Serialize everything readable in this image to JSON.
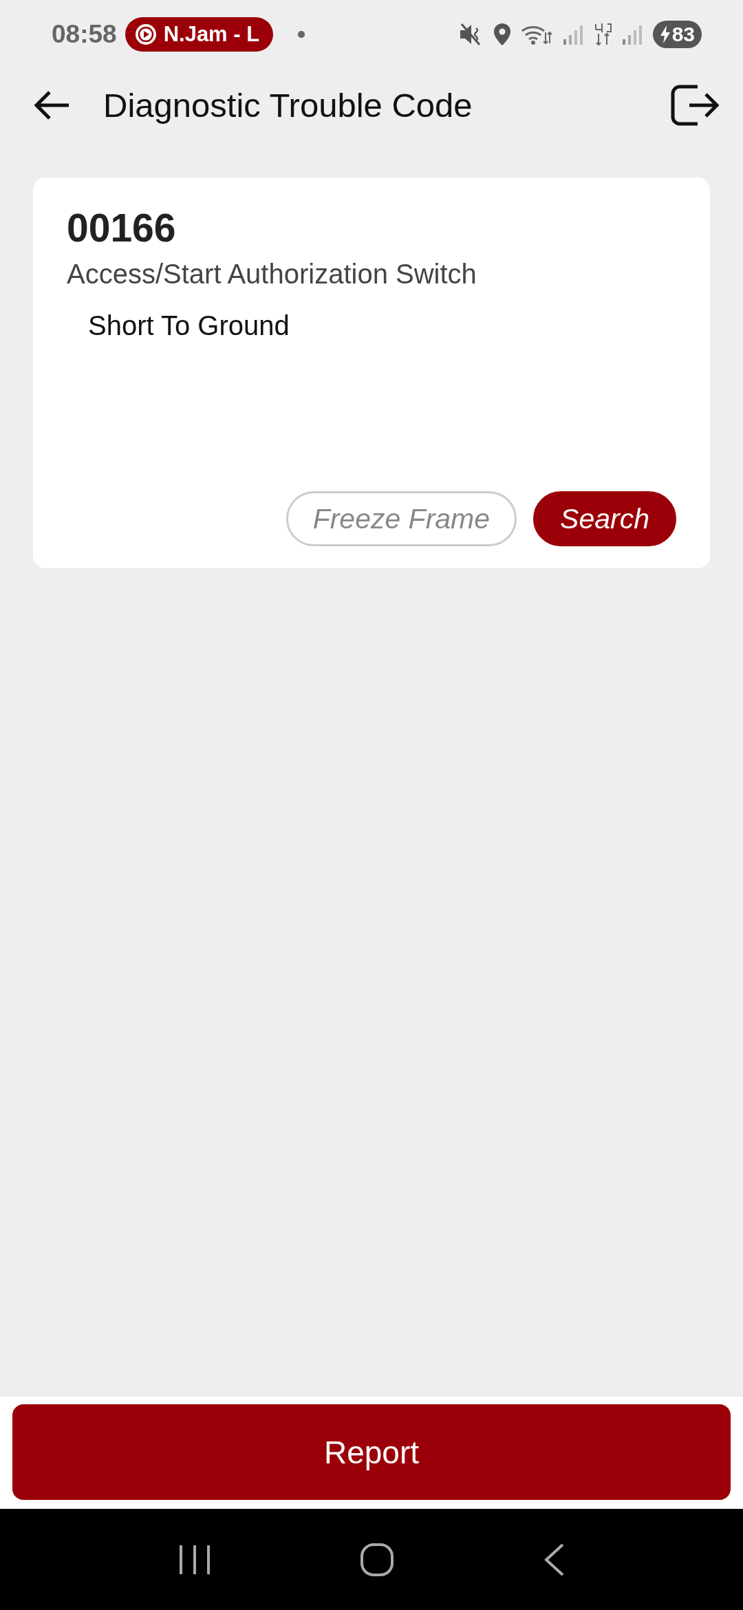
{
  "status_bar": {
    "time": "08:58",
    "media_chip": "N.Jam - L",
    "battery": "83"
  },
  "app_bar": {
    "title": "Diagnostic Trouble Code"
  },
  "dtc": {
    "code": "00166",
    "name": "Access/Start Authorization Switch",
    "status": "Short To Ground",
    "buttons": [
      {
        "label": "Freeze Frame",
        "disabled": true
      },
      {
        "label": "Search",
        "disabled": false
      }
    ]
  },
  "report_button": {
    "label": "Report"
  }
}
